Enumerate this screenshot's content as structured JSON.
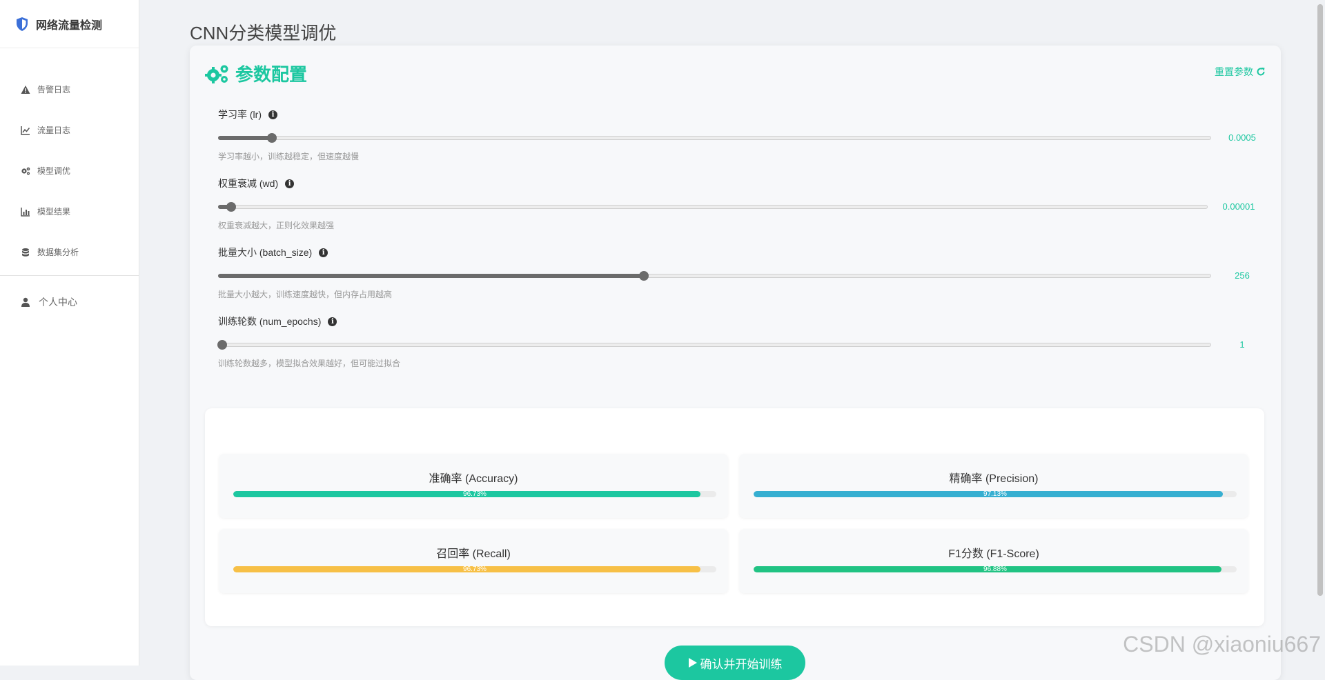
{
  "brand": {
    "title": "网络流量检测"
  },
  "sidebar": {
    "items": [
      {
        "label": "告警日志",
        "icon": "warning-icon"
      },
      {
        "label": "流量日志",
        "icon": "line-chart-icon"
      },
      {
        "label": "模型调优",
        "icon": "gears-icon"
      },
      {
        "label": "模型结果",
        "icon": "bar-chart-icon"
      },
      {
        "label": "数据集分析",
        "icon": "database-icon"
      }
    ],
    "profile": {
      "label": "个人中心",
      "icon": "user-icon"
    }
  },
  "page": {
    "title": "CNN分类模型调优"
  },
  "config": {
    "header": "参数配置",
    "reset_label": "重置参数",
    "params": [
      {
        "label": "学习率 (lr)",
        "value": "0.0005",
        "level": 0.054,
        "hint": "学习率越小，训练越稳定，但速度越慢"
      },
      {
        "label": "权重衰减 (wd)",
        "value": "0.00001",
        "level": 0.013,
        "hint": "权重衰减越大，正则化效果越强"
      },
      {
        "label": "批量大小 (batch_size)",
        "value": "256",
        "level": 0.429,
        "hint": "批量大小越大，训练速度越快，但内存占用越高"
      },
      {
        "label": "训练轮数 (num_epochs)",
        "value": "1",
        "level": 0.004,
        "hint": "训练轮数越多，模型拟合效果越好，但可能过拟合"
      }
    ]
  },
  "metrics": [
    {
      "label": "准确率 (Accuracy)",
      "value_text": "96.73%",
      "percent": 96.73,
      "color": "#1cc7a0"
    },
    {
      "label": "精确率 (Precision)",
      "value_text": "97.13%",
      "percent": 97.13,
      "color": "#36afd1"
    },
    {
      "label": "召回率 (Recall)",
      "value_text": "96.73%",
      "percent": 96.73,
      "color": "#f7c046"
    },
    {
      "label": "F1分数 (F1-Score)",
      "value_text": "96.88%",
      "percent": 96.88,
      "color": "#21c383"
    }
  ],
  "train_button": {
    "label": "确认并开始训练"
  },
  "watermark": "CSDN @xiaoniu667"
}
